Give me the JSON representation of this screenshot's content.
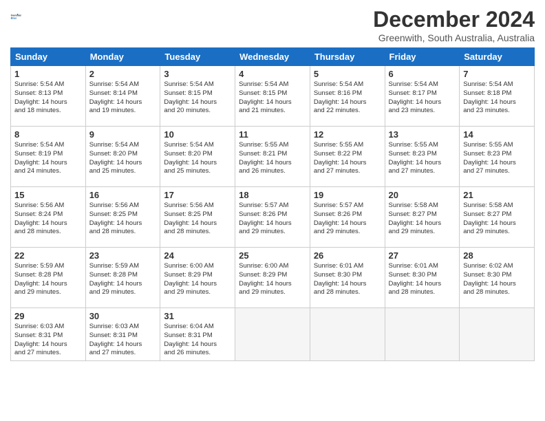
{
  "header": {
    "logo": {
      "line1": "General",
      "line2": "Blue"
    },
    "title": "December 2024",
    "subtitle": "Greenwith, South Australia, Australia"
  },
  "weekdays": [
    "Sunday",
    "Monday",
    "Tuesday",
    "Wednesday",
    "Thursday",
    "Friday",
    "Saturday"
  ],
  "weeks": [
    [
      {
        "day": "1",
        "info": "Sunrise: 5:54 AM\nSunset: 8:13 PM\nDaylight: 14 hours\nand 18 minutes."
      },
      {
        "day": "2",
        "info": "Sunrise: 5:54 AM\nSunset: 8:14 PM\nDaylight: 14 hours\nand 19 minutes."
      },
      {
        "day": "3",
        "info": "Sunrise: 5:54 AM\nSunset: 8:15 PM\nDaylight: 14 hours\nand 20 minutes."
      },
      {
        "day": "4",
        "info": "Sunrise: 5:54 AM\nSunset: 8:15 PM\nDaylight: 14 hours\nand 21 minutes."
      },
      {
        "day": "5",
        "info": "Sunrise: 5:54 AM\nSunset: 8:16 PM\nDaylight: 14 hours\nand 22 minutes."
      },
      {
        "day": "6",
        "info": "Sunrise: 5:54 AM\nSunset: 8:17 PM\nDaylight: 14 hours\nand 23 minutes."
      },
      {
        "day": "7",
        "info": "Sunrise: 5:54 AM\nSunset: 8:18 PM\nDaylight: 14 hours\nand 23 minutes."
      }
    ],
    [
      {
        "day": "8",
        "info": "Sunrise: 5:54 AM\nSunset: 8:19 PM\nDaylight: 14 hours\nand 24 minutes."
      },
      {
        "day": "9",
        "info": "Sunrise: 5:54 AM\nSunset: 8:20 PM\nDaylight: 14 hours\nand 25 minutes."
      },
      {
        "day": "10",
        "info": "Sunrise: 5:54 AM\nSunset: 8:20 PM\nDaylight: 14 hours\nand 25 minutes."
      },
      {
        "day": "11",
        "info": "Sunrise: 5:55 AM\nSunset: 8:21 PM\nDaylight: 14 hours\nand 26 minutes."
      },
      {
        "day": "12",
        "info": "Sunrise: 5:55 AM\nSunset: 8:22 PM\nDaylight: 14 hours\nand 27 minutes."
      },
      {
        "day": "13",
        "info": "Sunrise: 5:55 AM\nSunset: 8:23 PM\nDaylight: 14 hours\nand 27 minutes."
      },
      {
        "day": "14",
        "info": "Sunrise: 5:55 AM\nSunset: 8:23 PM\nDaylight: 14 hours\nand 27 minutes."
      }
    ],
    [
      {
        "day": "15",
        "info": "Sunrise: 5:56 AM\nSunset: 8:24 PM\nDaylight: 14 hours\nand 28 minutes."
      },
      {
        "day": "16",
        "info": "Sunrise: 5:56 AM\nSunset: 8:25 PM\nDaylight: 14 hours\nand 28 minutes."
      },
      {
        "day": "17",
        "info": "Sunrise: 5:56 AM\nSunset: 8:25 PM\nDaylight: 14 hours\nand 28 minutes."
      },
      {
        "day": "18",
        "info": "Sunrise: 5:57 AM\nSunset: 8:26 PM\nDaylight: 14 hours\nand 29 minutes."
      },
      {
        "day": "19",
        "info": "Sunrise: 5:57 AM\nSunset: 8:26 PM\nDaylight: 14 hours\nand 29 minutes."
      },
      {
        "day": "20",
        "info": "Sunrise: 5:58 AM\nSunset: 8:27 PM\nDaylight: 14 hours\nand 29 minutes."
      },
      {
        "day": "21",
        "info": "Sunrise: 5:58 AM\nSunset: 8:27 PM\nDaylight: 14 hours\nand 29 minutes."
      }
    ],
    [
      {
        "day": "22",
        "info": "Sunrise: 5:59 AM\nSunset: 8:28 PM\nDaylight: 14 hours\nand 29 minutes."
      },
      {
        "day": "23",
        "info": "Sunrise: 5:59 AM\nSunset: 8:28 PM\nDaylight: 14 hours\nand 29 minutes."
      },
      {
        "day": "24",
        "info": "Sunrise: 6:00 AM\nSunset: 8:29 PM\nDaylight: 14 hours\nand 29 minutes."
      },
      {
        "day": "25",
        "info": "Sunrise: 6:00 AM\nSunset: 8:29 PM\nDaylight: 14 hours\nand 29 minutes."
      },
      {
        "day": "26",
        "info": "Sunrise: 6:01 AM\nSunset: 8:30 PM\nDaylight: 14 hours\nand 28 minutes."
      },
      {
        "day": "27",
        "info": "Sunrise: 6:01 AM\nSunset: 8:30 PM\nDaylight: 14 hours\nand 28 minutes."
      },
      {
        "day": "28",
        "info": "Sunrise: 6:02 AM\nSunset: 8:30 PM\nDaylight: 14 hours\nand 28 minutes."
      }
    ],
    [
      {
        "day": "29",
        "info": "Sunrise: 6:03 AM\nSunset: 8:31 PM\nDaylight: 14 hours\nand 27 minutes."
      },
      {
        "day": "30",
        "info": "Sunrise: 6:03 AM\nSunset: 8:31 PM\nDaylight: 14 hours\nand 27 minutes."
      },
      {
        "day": "31",
        "info": "Sunrise: 6:04 AM\nSunset: 8:31 PM\nDaylight: 14 hours\nand 26 minutes."
      },
      {
        "day": "",
        "info": ""
      },
      {
        "day": "",
        "info": ""
      },
      {
        "day": "",
        "info": ""
      },
      {
        "day": "",
        "info": ""
      }
    ]
  ]
}
